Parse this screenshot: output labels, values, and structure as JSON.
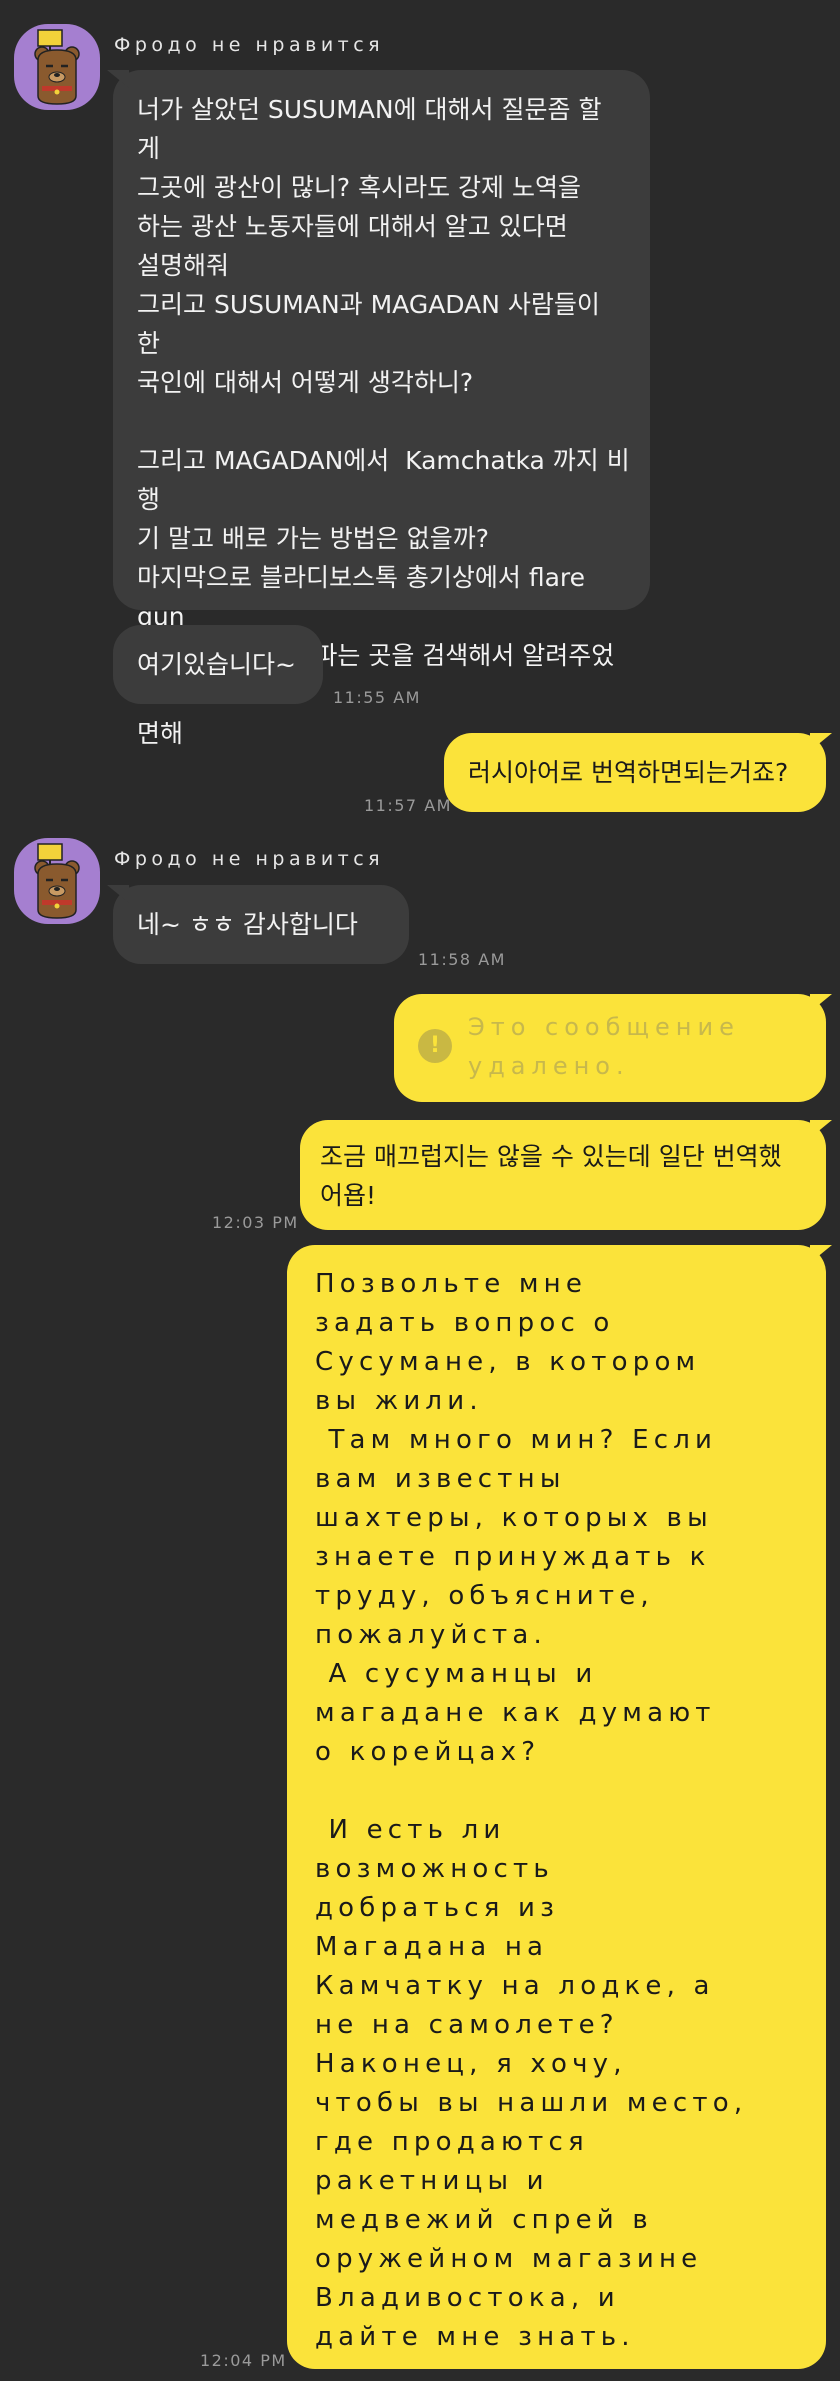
{
  "chat": {
    "messages": [
      {
        "sender": "Фродо не нравится",
        "text": "너가 살았던 SUSUMAN에 대해서 질문좀 할\n게\n그곳에 광산이 많니? 혹시라도 강제 노역을\n하는 광산 노동자들에 대해서 알고 있다면\n설명해줘\n그리고 SUSUMAN과 MAGADAN 사람들이 한\n국인에 대해서 어떻게 생각하니?\n\n그리고 MAGADAN에서  Kamchatka 까지 비행\n기 말고 배로 가는 방법은 없을까?\n마지막으로 블라디보스톡 총기상에서 flare gun\n& bear spray  파는 곳을 검색해서 알려주었으\n면해"
      },
      {
        "text": "여기있습니다~",
        "time": "11:55 AM"
      },
      {
        "text": "러시아어로 번역하면되는거죠?",
        "time": "11:57 AM"
      },
      {
        "sender": "Фродо не нравится",
        "text": "네~ ㅎㅎ 감사합니다",
        "time": "11:58 AM"
      },
      {
        "text": "Это сообщение\nудалено.",
        "icon": "exclamation-icon"
      },
      {
        "text": "조금 매끄럽지는 않을 수 있는데 일단 번역했\n어욥!",
        "time": "12:03 PM"
      },
      {
        "text": "Позвольте мне\nзадать вопрос о\nСусумане, в котором\nвы жили.\n Там много мин? Если\nвам известны\nшахтеры, которых вы\nзнаете принуждать к\nтруду, объясните,\nпожалуйста.\n А сусуманцы и\nмагадане как думают\nо корейцах?\n\n И есть ли\nвозможность\nдобраться из\nМагадана на\nКамчатку на лодке, а\nне на самолете?\nНаконец, я хочу,\nчтобы вы нашли место,\nгде продаются\nракетницы и\nмедвежий спрей в\nоружейном магазине\nВладивостока, и\nдайте мне знать.",
        "time": "12:04 PM"
      }
    ]
  },
  "colors": {
    "background": "#2a2a2a",
    "incoming_bubble": "#3c3c3c",
    "outgoing_bubble": "#fbe33a",
    "avatar_bg": "#a57fd0"
  }
}
